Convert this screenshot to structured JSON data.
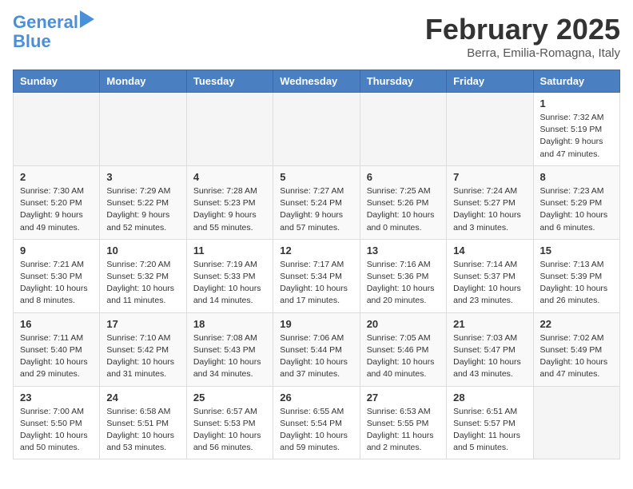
{
  "header": {
    "logo_line1": "General",
    "logo_line2": "Blue",
    "month_title": "February 2025",
    "location": "Berra, Emilia-Romagna, Italy"
  },
  "days_of_week": [
    "Sunday",
    "Monday",
    "Tuesday",
    "Wednesday",
    "Thursday",
    "Friday",
    "Saturday"
  ],
  "weeks": [
    [
      {
        "day": "",
        "info": ""
      },
      {
        "day": "",
        "info": ""
      },
      {
        "day": "",
        "info": ""
      },
      {
        "day": "",
        "info": ""
      },
      {
        "day": "",
        "info": ""
      },
      {
        "day": "",
        "info": ""
      },
      {
        "day": "1",
        "info": "Sunrise: 7:32 AM\nSunset: 5:19 PM\nDaylight: 9 hours and 47 minutes."
      }
    ],
    [
      {
        "day": "2",
        "info": "Sunrise: 7:30 AM\nSunset: 5:20 PM\nDaylight: 9 hours and 49 minutes."
      },
      {
        "day": "3",
        "info": "Sunrise: 7:29 AM\nSunset: 5:22 PM\nDaylight: 9 hours and 52 minutes."
      },
      {
        "day": "4",
        "info": "Sunrise: 7:28 AM\nSunset: 5:23 PM\nDaylight: 9 hours and 55 minutes."
      },
      {
        "day": "5",
        "info": "Sunrise: 7:27 AM\nSunset: 5:24 PM\nDaylight: 9 hours and 57 minutes."
      },
      {
        "day": "6",
        "info": "Sunrise: 7:25 AM\nSunset: 5:26 PM\nDaylight: 10 hours and 0 minutes."
      },
      {
        "day": "7",
        "info": "Sunrise: 7:24 AM\nSunset: 5:27 PM\nDaylight: 10 hours and 3 minutes."
      },
      {
        "day": "8",
        "info": "Sunrise: 7:23 AM\nSunset: 5:29 PM\nDaylight: 10 hours and 6 minutes."
      }
    ],
    [
      {
        "day": "9",
        "info": "Sunrise: 7:21 AM\nSunset: 5:30 PM\nDaylight: 10 hours and 8 minutes."
      },
      {
        "day": "10",
        "info": "Sunrise: 7:20 AM\nSunset: 5:32 PM\nDaylight: 10 hours and 11 minutes."
      },
      {
        "day": "11",
        "info": "Sunrise: 7:19 AM\nSunset: 5:33 PM\nDaylight: 10 hours and 14 minutes."
      },
      {
        "day": "12",
        "info": "Sunrise: 7:17 AM\nSunset: 5:34 PM\nDaylight: 10 hours and 17 minutes."
      },
      {
        "day": "13",
        "info": "Sunrise: 7:16 AM\nSunset: 5:36 PM\nDaylight: 10 hours and 20 minutes."
      },
      {
        "day": "14",
        "info": "Sunrise: 7:14 AM\nSunset: 5:37 PM\nDaylight: 10 hours and 23 minutes."
      },
      {
        "day": "15",
        "info": "Sunrise: 7:13 AM\nSunset: 5:39 PM\nDaylight: 10 hours and 26 minutes."
      }
    ],
    [
      {
        "day": "16",
        "info": "Sunrise: 7:11 AM\nSunset: 5:40 PM\nDaylight: 10 hours and 29 minutes."
      },
      {
        "day": "17",
        "info": "Sunrise: 7:10 AM\nSunset: 5:42 PM\nDaylight: 10 hours and 31 minutes."
      },
      {
        "day": "18",
        "info": "Sunrise: 7:08 AM\nSunset: 5:43 PM\nDaylight: 10 hours and 34 minutes."
      },
      {
        "day": "19",
        "info": "Sunrise: 7:06 AM\nSunset: 5:44 PM\nDaylight: 10 hours and 37 minutes."
      },
      {
        "day": "20",
        "info": "Sunrise: 7:05 AM\nSunset: 5:46 PM\nDaylight: 10 hours and 40 minutes."
      },
      {
        "day": "21",
        "info": "Sunrise: 7:03 AM\nSunset: 5:47 PM\nDaylight: 10 hours and 43 minutes."
      },
      {
        "day": "22",
        "info": "Sunrise: 7:02 AM\nSunset: 5:49 PM\nDaylight: 10 hours and 47 minutes."
      }
    ],
    [
      {
        "day": "23",
        "info": "Sunrise: 7:00 AM\nSunset: 5:50 PM\nDaylight: 10 hours and 50 minutes."
      },
      {
        "day": "24",
        "info": "Sunrise: 6:58 AM\nSunset: 5:51 PM\nDaylight: 10 hours and 53 minutes."
      },
      {
        "day": "25",
        "info": "Sunrise: 6:57 AM\nSunset: 5:53 PM\nDaylight: 10 hours and 56 minutes."
      },
      {
        "day": "26",
        "info": "Sunrise: 6:55 AM\nSunset: 5:54 PM\nDaylight: 10 hours and 59 minutes."
      },
      {
        "day": "27",
        "info": "Sunrise: 6:53 AM\nSunset: 5:55 PM\nDaylight: 11 hours and 2 minutes."
      },
      {
        "day": "28",
        "info": "Sunrise: 6:51 AM\nSunset: 5:57 PM\nDaylight: 11 hours and 5 minutes."
      },
      {
        "day": "",
        "info": ""
      }
    ]
  ]
}
